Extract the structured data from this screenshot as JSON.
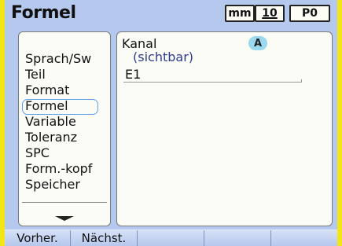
{
  "header": {
    "title": "Formel",
    "unit": "mm",
    "resolution": "10",
    "preset": "P0"
  },
  "menu": {
    "items": [
      {
        "label": "Sprach/Sw",
        "selected": false
      },
      {
        "label": "Teil",
        "selected": false
      },
      {
        "label": "Format",
        "selected": false
      },
      {
        "label": "Formel",
        "selected": true
      },
      {
        "label": "Variable",
        "selected": false
      },
      {
        "label": "Toleranz",
        "selected": false
      },
      {
        "label": "SPC",
        "selected": false
      },
      {
        "label": "Form.-kopf",
        "selected": false
      },
      {
        "label": "Speicher",
        "selected": false
      }
    ],
    "scroll_icon": "arrow-down-icon"
  },
  "content": {
    "label": "Kanal",
    "badge": "A",
    "sublabel": "(sichtbar)",
    "field_value": "E1"
  },
  "softkeys": [
    {
      "label": "Vorher."
    },
    {
      "label": "Nächst."
    },
    {
      "label": ""
    },
    {
      "label": ""
    },
    {
      "label": ""
    }
  ],
  "colors": {
    "bezel": "#f3e617",
    "background": "#b5c9ef",
    "panel": "#fbfcf6",
    "badge": "#9ad9ee",
    "subtext": "#2f3a8f"
  }
}
